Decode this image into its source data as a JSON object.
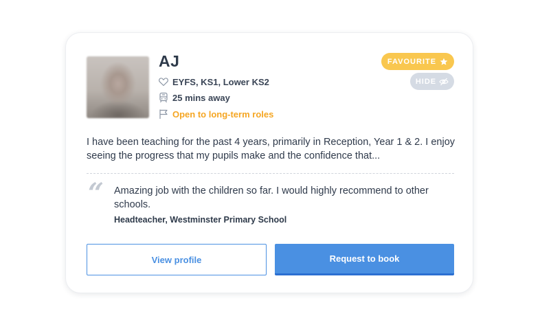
{
  "candidate": {
    "name": "AJ",
    "subjects": "EYFS, KS1, Lower KS2",
    "distance": "25 mins away",
    "availability": "Open to long-term roles",
    "bio": "I have been teaching for the past 4 years, primarily in Reception, Year 1 & 2. I enjoy seeing the progress that my pupils make and the confidence that..."
  },
  "actions": {
    "favourite_label": "FAVOURITE",
    "hide_label": "HIDE",
    "view_profile_label": "View profile",
    "request_label": "Request to book"
  },
  "testimonial": {
    "quote_mark": "“",
    "text": "Amazing job with the children so far. I would highly recommend to other schools.",
    "author": "Headteacher, Westminster Primary School"
  },
  "icons": {
    "subjects": "heart-icon",
    "distance": "train-icon",
    "availability": "flag-icon",
    "favourite": "star-icon",
    "hide": "eye-slash-icon"
  },
  "colors": {
    "primary": "#4a90e2",
    "favourite": "#f9c74f",
    "hide": "#d5dbe4",
    "availability": "#f5a623",
    "text": "#2f3a4b"
  }
}
